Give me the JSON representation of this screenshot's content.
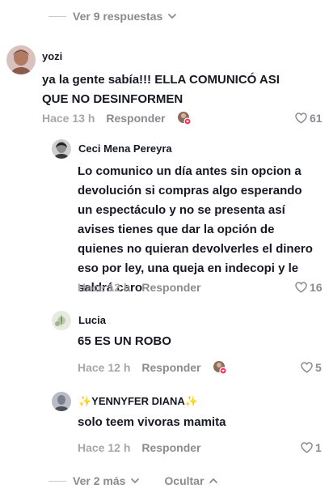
{
  "top_toggle": {
    "label": "Ver 9 respuestas"
  },
  "comments": [
    {
      "username": "yozi",
      "text": "ya la gente sabía!!! ELLA COMUNICÓ ASI QUE NO DESINFORMEN",
      "time": "Hace 13 h",
      "reply": "Responder",
      "likes": "61"
    },
    {
      "username": "Ceci Mena Pereyra",
      "text": "Lo comunico un día antes sin opcion a devolución si compras algo esperando un espectáculo y no se presenta así avises tienes que dar la opción de quienes no quieran devolverles el dinero eso por ley, una queja en indecopi y le saldrá caro",
      "time": "Hace 12 h",
      "reply": "Responder",
      "likes": "16"
    },
    {
      "username": "Lucia",
      "text": "65 ES UN ROBO",
      "time": "Hace 12 h",
      "reply": "Responder",
      "likes": "5"
    },
    {
      "username": "✨YENNYFER DIANA✨",
      "text": "solo teem vivoras mamita",
      "time": "Hace 12 h",
      "reply": "Responder",
      "likes": "1"
    }
  ],
  "bottom": {
    "more_label": "Ver 2 más",
    "hide_label": "Ocultar"
  },
  "colors": {
    "text": "#161823",
    "muted": "#8a8b91",
    "creator_badge": "#fe2c55"
  }
}
